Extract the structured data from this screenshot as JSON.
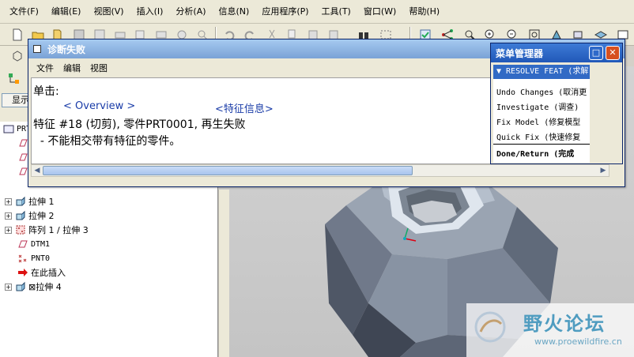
{
  "menubar": {
    "items": [
      "文件(F)",
      "编辑(E)",
      "视图(V)",
      "插入(I)",
      "分析(A)",
      "信息(N)",
      "应用程序(P)",
      "工具(T)",
      "窗口(W)",
      "帮助(H)"
    ]
  },
  "left_panel": {
    "show_button": "显示"
  },
  "model_tree": {
    "items": [
      {
        "label": "PRT",
        "icon": "part-icon",
        "expand": ""
      },
      {
        "label": "拉伸 1",
        "icon": "extrude-icon",
        "expand": "+"
      },
      {
        "label": "拉伸 2",
        "icon": "extrude-icon",
        "expand": "+"
      },
      {
        "label": "阵列 1 / 拉伸 3",
        "icon": "pattern-icon",
        "expand": "+"
      },
      {
        "label": "DTM1",
        "icon": "datum-plane-icon",
        "expand": ""
      },
      {
        "label": "PNT0",
        "icon": "datum-point-icon",
        "expand": ""
      },
      {
        "label": "在此插入",
        "icon": "insert-here-arrow-icon",
        "expand": ""
      },
      {
        "label": "⊠拉伸 4",
        "icon": "extrude-icon",
        "expand": "+"
      }
    ]
  },
  "diagnosis_dialog": {
    "title": "诊断失败",
    "menu": [
      "文件",
      "编辑",
      "视图"
    ],
    "line1": "单击:",
    "link_overview": "< Overview >",
    "link_feature_info": "<特征信息>",
    "line3": "特征 #18 (切剪), 零件PRT0001,  再生失败",
    "line4": "  - 不能相交带有特征的零件。"
  },
  "menu_manager": {
    "title": "菜单管理器",
    "header": "▼ RESOLVE FEAT (求解",
    "options": [
      "Undo Changes (取消更",
      "Investigate (调查)",
      "Fix Model (修复模型",
      "Quick Fix (快速修复"
    ],
    "done": "Done/Return (完成"
  },
  "watermark": {
    "title": "野火论坛",
    "url": "www.proewildfire.cn"
  },
  "colors": {
    "title_active": "#2158b8",
    "title_inactive": "#7aa2d6",
    "selected_row": "#316ac5",
    "link": "#1a3ca8",
    "model_fill": "#8b96a4"
  }
}
